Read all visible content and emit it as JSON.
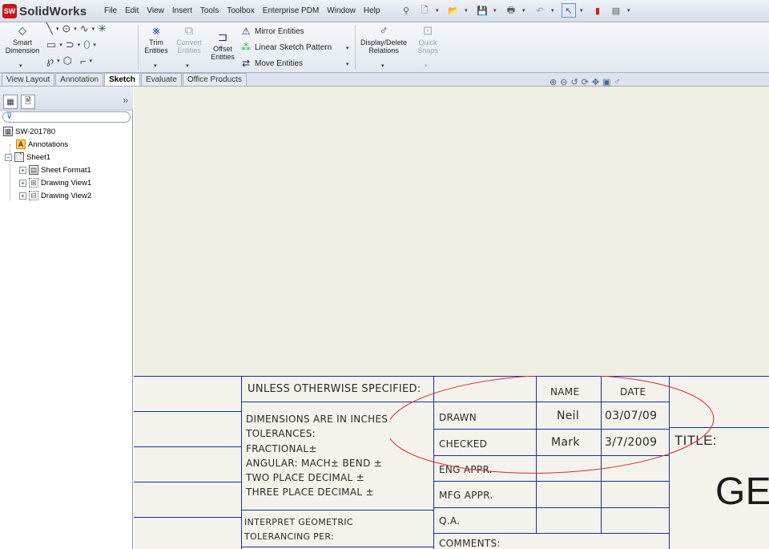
{
  "app": {
    "name": "SolidWorks",
    "logo_mark": "SW"
  },
  "menu": [
    "File",
    "Edit",
    "View",
    "Insert",
    "Tools",
    "Toolbox",
    "Enterprise PDM",
    "Window",
    "Help"
  ],
  "quick_access": [
    "pin-icon",
    "new-document-icon",
    "open-icon",
    "save-icon",
    "print-icon",
    "undo-icon",
    "select-icon",
    "rebuild-icon",
    "options-icon"
  ],
  "ribbon": {
    "smart_dimension": "Smart Dimension",
    "trim_entities": "Trim Entities",
    "convert_entities": "Convert Entities",
    "offset_entities": "Offset Entities",
    "mirror_entities": "Mirror Entities",
    "linear_sketch_pattern": "Linear Sketch Pattern",
    "move_entities": "Move Entities",
    "display_delete_relations": "Display/Delete Relations",
    "quick_snaps": "Quick Snaps"
  },
  "tabs": [
    {
      "label": "View Layout",
      "active": false
    },
    {
      "label": "Annotation",
      "active": false
    },
    {
      "label": "Sketch",
      "active": true
    },
    {
      "label": "Evaluate",
      "active": false
    },
    {
      "label": "Office Products",
      "active": false
    }
  ],
  "tree": {
    "root": "SW-201780",
    "annotations": "Annotations",
    "sheet": "Sheet1",
    "sheet_format": "Sheet Format1",
    "view1": "Drawing View1",
    "view2": "Drawing View2"
  },
  "title_block": {
    "unless": "UNLESS OTHERWISE SPECIFIED:",
    "dims": "DIMENSIONS ARE IN INCHES",
    "tolerances": "TOLERANCES:",
    "fractional": "FRACTIONAL±",
    "angular": "ANGULAR: MACH±    BEND ±",
    "two_place": "TWO PLACE DECIMAL    ±",
    "three_place": "THREE PLACE DECIMAL  ±",
    "interpret": "INTERPRET GEOMETRIC",
    "tol_per": "TOLERANCING PER:",
    "header_name": "NAME",
    "header_date": "DATE",
    "drawn": "DRAWN",
    "drawn_name": "Neil",
    "drawn_date": "03/07/09",
    "checked": "CHECKED",
    "checked_name": "Mark",
    "checked_date": "3/7/2009",
    "eng_appr": "ENG APPR.",
    "mfg_appr": "MFG APPR.",
    "qa": "Q.A.",
    "comments": "COMMENTS:",
    "title": "TITLE:",
    "title_value": "GE"
  },
  "colors": {
    "border": "#1c2aa8",
    "annotation_ellipse": "#d42a2a",
    "sheet": "#f3f3ec",
    "canvas": "#efefe4"
  }
}
